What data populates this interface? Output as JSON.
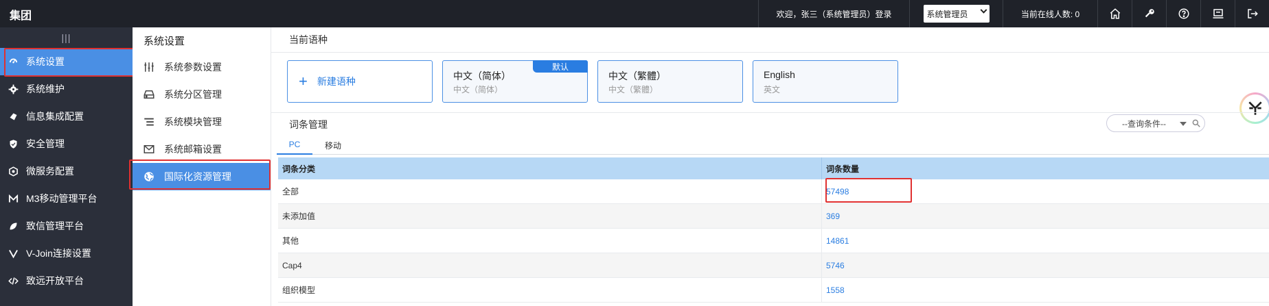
{
  "topbar": {
    "brand": "集团",
    "welcome": "欢迎，张三（系统管理员）登录",
    "role_select": "系统管理员",
    "online": "当前在线人数: 0",
    "icons": [
      "home-icon",
      "key-icon",
      "help-icon",
      "monitor-icon",
      "logout-icon"
    ]
  },
  "leftnav": {
    "handle": "|||",
    "items": [
      {
        "label": "系统设置",
        "icon": "dashboard-icon"
      },
      {
        "label": "系统维护",
        "icon": "gear-icon"
      },
      {
        "label": "信息集成配置",
        "icon": "puzzle-icon"
      },
      {
        "label": "安全管理",
        "icon": "shield-icon"
      },
      {
        "label": "微服务配置",
        "icon": "hexagon-icon"
      },
      {
        "label": "M3移动管理平台",
        "icon": "m-icon"
      },
      {
        "label": "致信管理平台",
        "icon": "leaf-icon"
      },
      {
        "label": "V-Join连接设置",
        "icon": "v-icon"
      },
      {
        "label": "致远开放平台",
        "icon": "code-icon"
      }
    ]
  },
  "submenu": {
    "title": "系统设置",
    "items": [
      {
        "label": "系统参数设置",
        "icon": "sliders-icon"
      },
      {
        "label": "系统分区管理",
        "icon": "drive-icon"
      },
      {
        "label": "系统模块管理",
        "icon": "list-icon"
      },
      {
        "label": "系统邮箱设置",
        "icon": "mail-icon"
      },
      {
        "label": "国际化资源管理",
        "icon": "globe-icon"
      }
    ]
  },
  "main": {
    "lang_title": "当前语种",
    "new_lang": "新建语种",
    "languages": [
      {
        "name": "中文（简体）",
        "sub": "中文（简体）",
        "badge": "默认"
      },
      {
        "name": "中文（繁體）",
        "sub": "中文（繁體）"
      },
      {
        "name": "English",
        "sub": "英文"
      }
    ],
    "entry_title": "词条管理",
    "search_placeholder": "--查询条件--",
    "tabs": [
      "PC",
      "移动"
    ],
    "table": {
      "headers": [
        "词条分类",
        "词条数量"
      ],
      "rows": [
        {
          "category": "全部",
          "count": "57498"
        },
        {
          "category": "未添加值",
          "count": "369"
        },
        {
          "category": "其他",
          "count": "14861"
        },
        {
          "category": "Cap4",
          "count": "5746"
        },
        {
          "category": "组织模型",
          "count": "1558"
        }
      ]
    }
  },
  "colors": {
    "accent": "#4a8fe4",
    "link": "#2a7de1",
    "dark": "#1f2229",
    "nav": "#2b2f3a",
    "highlight": "#e03030"
  }
}
